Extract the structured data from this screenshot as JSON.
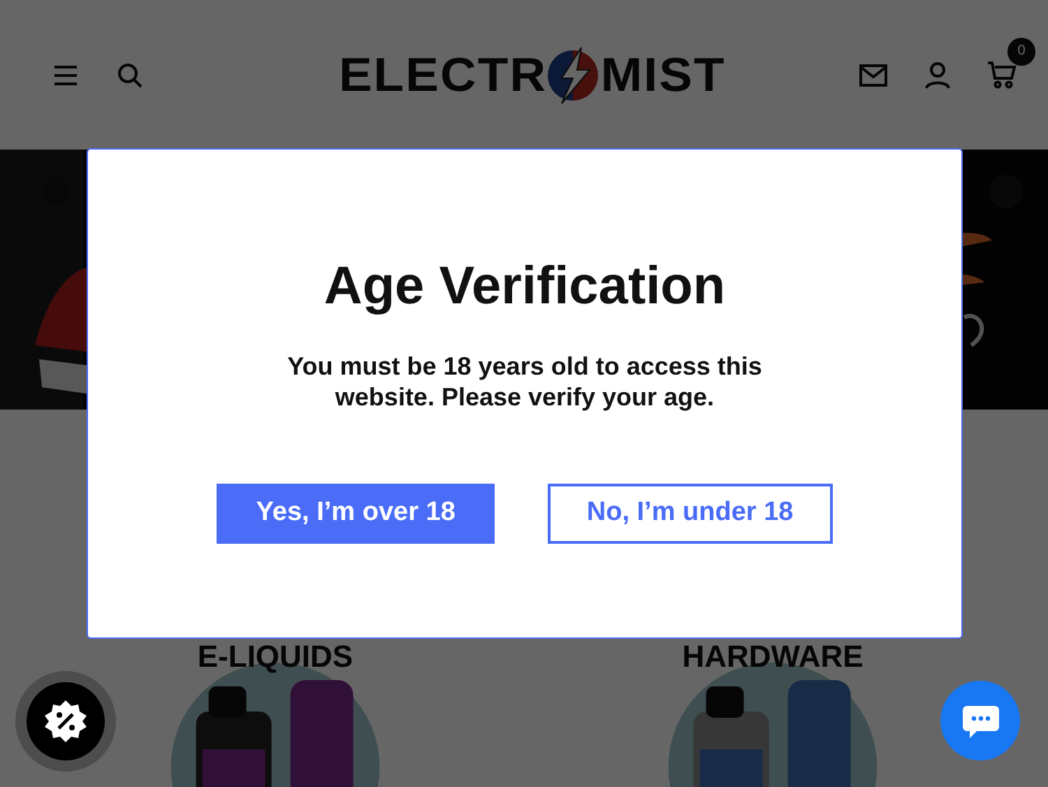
{
  "header": {
    "logo": [
      "ELECTR",
      "MIST"
    ],
    "cart_count": "0"
  },
  "categories": [
    {
      "title": "E-LIQUIDS",
      "kind": "picture"
    },
    {
      "title": "HARDWARE",
      "kind": "picture"
    }
  ],
  "modal": {
    "title": "Age Verification",
    "message": "You must be 18 years old to access this website. Please verify your age.",
    "buttons": [
      {
        "label": "Yes, I’m over 18",
        "kind": "primary"
      },
      {
        "label": "No, I’m under 18",
        "kind": "outline"
      }
    ]
  }
}
